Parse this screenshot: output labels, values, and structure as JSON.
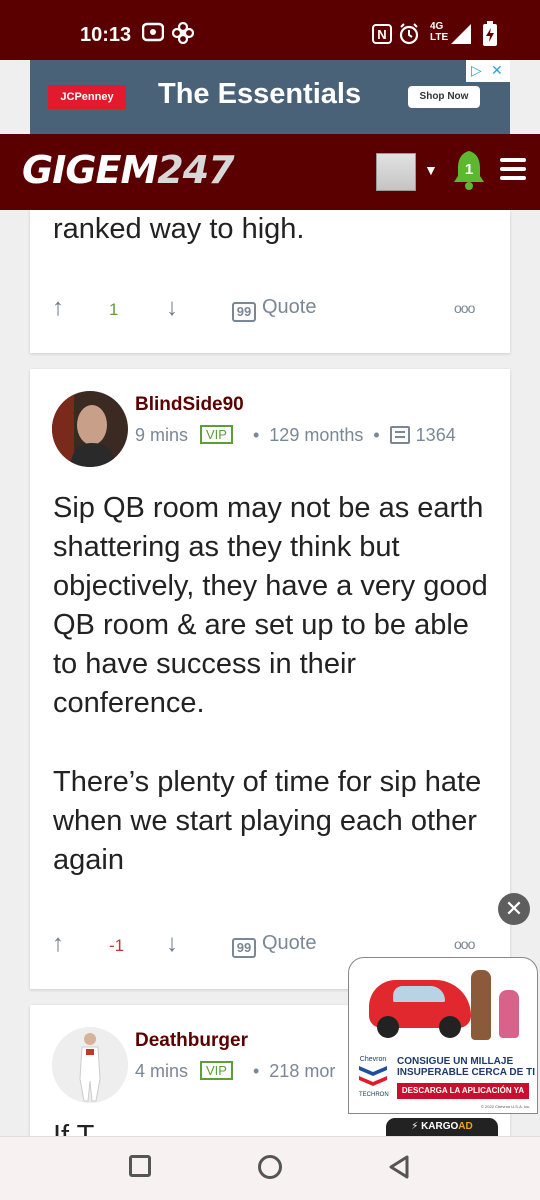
{
  "status_bar": {
    "time": "10:13",
    "network_top": "4G",
    "network_bottom": "LTE",
    "nfc_label": "N"
  },
  "ad_banner": {
    "brand": "JCPenney",
    "headline": "The Essentials",
    "cta": "Shop Now"
  },
  "header": {
    "logo_text": "GIGEM",
    "logo_number": "247",
    "notification_count": "1"
  },
  "posts": [
    {
      "text": "ranked way to high.",
      "score": "1",
      "quote_label": "Quote"
    },
    {
      "author": "BlindSide90",
      "time": "9 mins",
      "badge": "VIP",
      "tenure": "129 months",
      "post_count": "1364",
      "paragraphs": [
        "Sip QB room may not be as earth shattering as they think but objectively, they have a very good QB room & are set up to be able to have success in their conference.",
        "There’s plenty of time for sip hate when we start playing each other again"
      ],
      "score": "-1",
      "quote_label": "Quote"
    },
    {
      "author": "Deathburger",
      "time": "4 mins",
      "badge": "VIP",
      "tenure": "218 mor",
      "text": "If T"
    }
  ],
  "floating_ad": {
    "brand_label": "Chevron",
    "techron_label": "TECHRON",
    "headline_line1": "CONSIGUE UN MILLAJE",
    "headline_line2": "INSUPERABLE CERCA DE TI",
    "cta": "DESCARGA LA APLICACIÓN YA",
    "legal": "© 2022 Chevron U.S.A. Inc.",
    "footer_prefix": "KARGO",
    "footer_suffix": "AD"
  },
  "colors": {
    "brand_maroon": "#5a0000",
    "vip_green": "#5c9e3a",
    "upvote_green": "#5c9e3a",
    "downvote_red": "#c0392b",
    "meta_gray": "#7a8896"
  },
  "icons": {
    "upvote": "arrow-up-icon",
    "downvote": "arrow-down-icon",
    "quote": "quote-icon",
    "more": "more-icon",
    "posts": "posts-icon",
    "notifications": "bell-icon",
    "menu": "hamburger-icon"
  }
}
